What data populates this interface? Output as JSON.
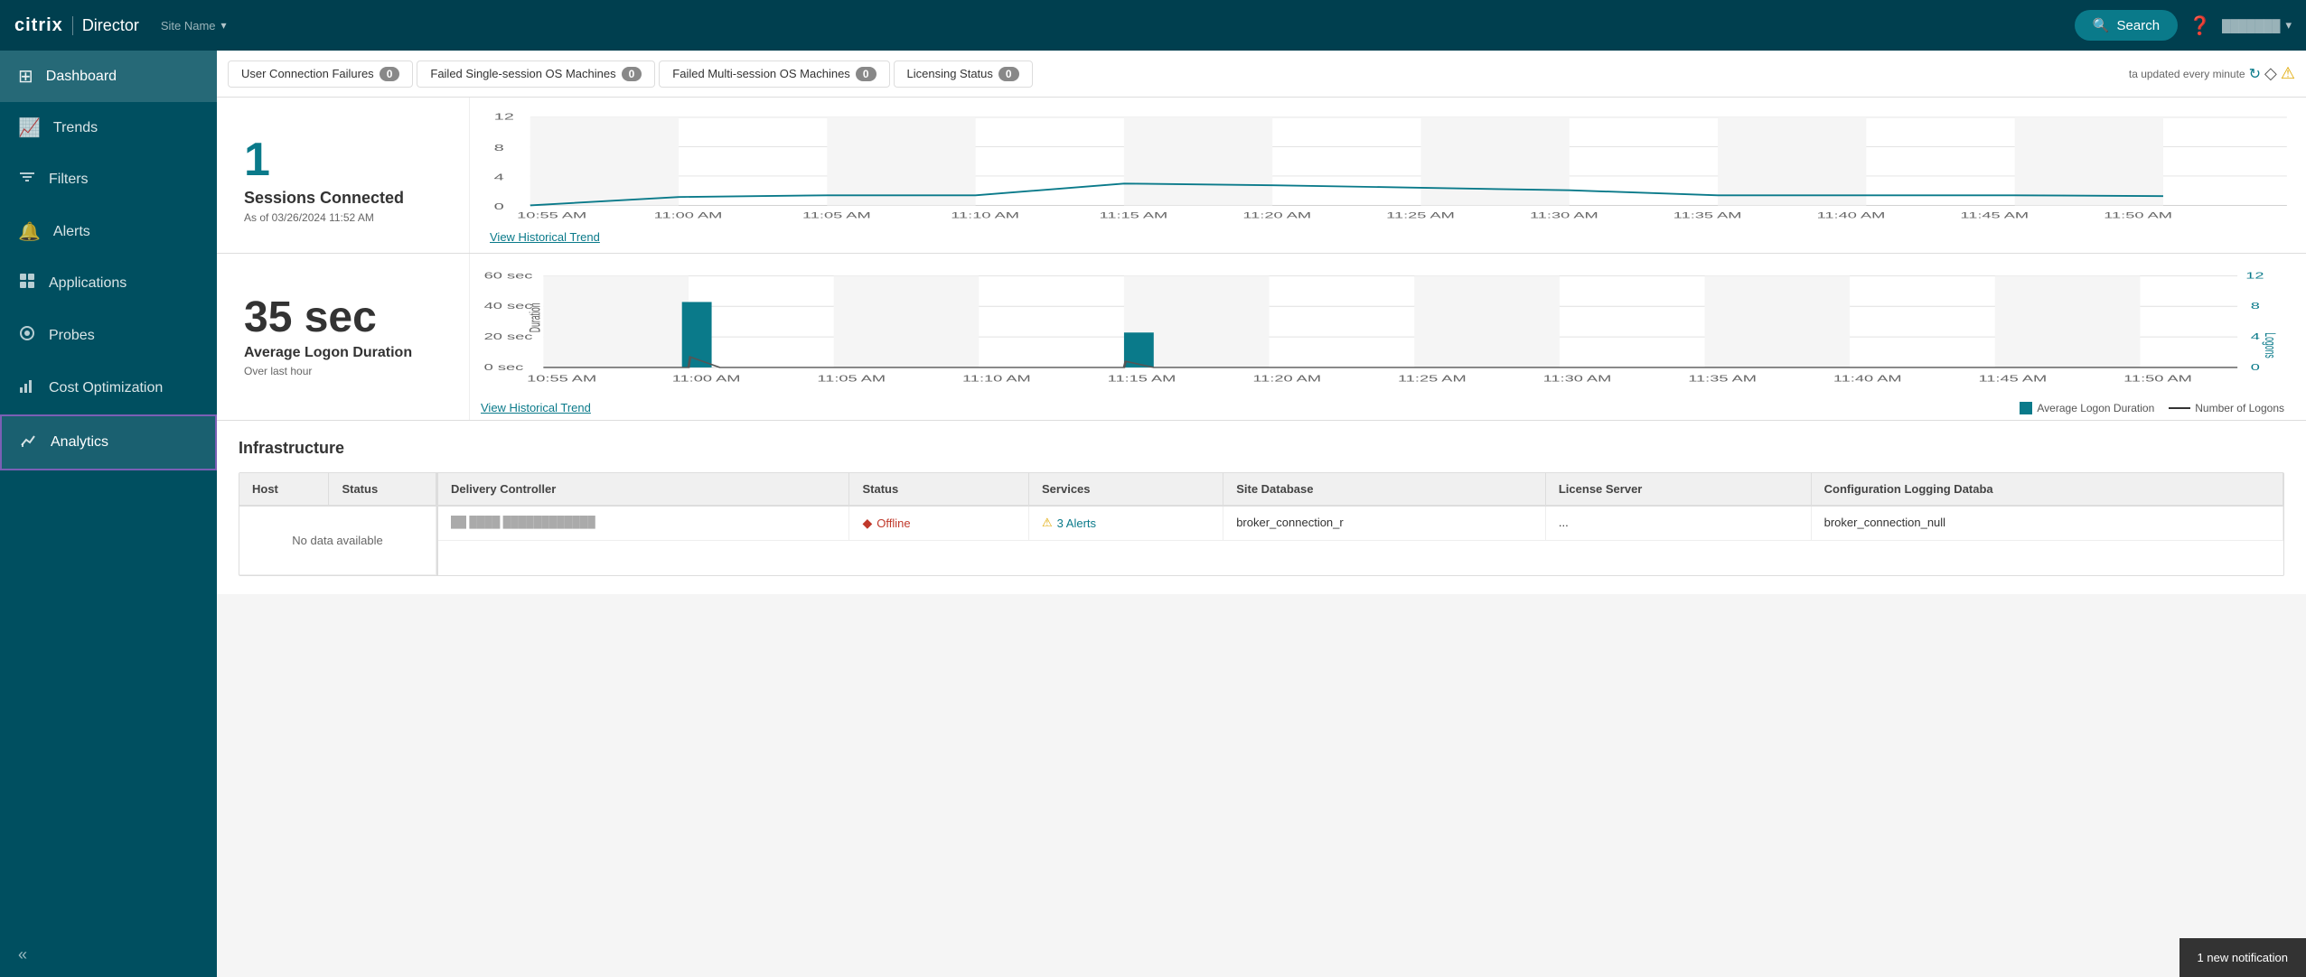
{
  "topNav": {
    "logo": "citrix",
    "appName": "Director",
    "siteSelector": "Site Name",
    "searchLabel": "Search",
    "helpLabel": "?",
    "userLabel": "Username"
  },
  "sidebar": {
    "items": [
      {
        "id": "dashboard",
        "label": "Dashboard",
        "icon": "⊞",
        "active": true
      },
      {
        "id": "trends",
        "label": "Trends",
        "icon": "📈"
      },
      {
        "id": "filters",
        "label": "Filters",
        "icon": "⚙"
      },
      {
        "id": "alerts",
        "label": "Alerts",
        "icon": "🔔"
      },
      {
        "id": "applications",
        "label": "Applications",
        "icon": "▣"
      },
      {
        "id": "probes",
        "label": "Probes",
        "icon": "⊙"
      },
      {
        "id": "costOptimization",
        "label": "Cost Optimization",
        "icon": "📊"
      },
      {
        "id": "analytics",
        "label": "Analytics",
        "icon": "📉",
        "selected": true
      }
    ],
    "collapseLabel": "«"
  },
  "alertBar": {
    "items": [
      {
        "id": "userConnFailures",
        "label": "User Connection Failures",
        "count": "0"
      },
      {
        "id": "failedSingle",
        "label": "Failed Single-session OS Machines",
        "count": "0"
      },
      {
        "id": "failedMulti",
        "label": "Failed Multi-session OS Machines",
        "count": "0"
      },
      {
        "id": "licensingStatus",
        "label": "Licensing Status",
        "count": "0"
      }
    ],
    "updateText": "ta updated every minute"
  },
  "sessionsChart": {
    "metricValue": "1",
    "metricLabel": "Sessions Connected",
    "metricSub": "As of 03/26/2024 11:52 AM",
    "viewTrendLabel": "View Historical Trend",
    "timeLabels": [
      "10:55 AM",
      "11:00 AM",
      "11:05 AM",
      "11:10 AM",
      "11:15 AM",
      "11:20 AM",
      "11:25 AM",
      "11:30 AM",
      "11:35 AM",
      "11:40 AM",
      "11:45 AM",
      "11:50 AM"
    ],
    "yLabels": [
      "0",
      "4",
      "8",
      "12"
    ],
    "dataPoints": [
      0,
      0.3,
      0.4,
      0.4,
      1.2,
      1.0,
      0.8,
      0.6,
      0.3,
      0.3,
      0.3,
      0.2
    ]
  },
  "logonChart": {
    "metricValue": "35 sec",
    "metricLabel": "Average Logon Duration",
    "metricSub": "Over last hour",
    "viewTrendLabel": "View Historical Trend",
    "timeLabels": [
      "10:55 AM",
      "11:00 AM",
      "11:05 AM",
      "11:10 AM",
      "11:15 AM",
      "11:20 AM",
      "11:25 AM",
      "11:30 AM",
      "11:35 AM",
      "11:40 AM",
      "11:45 AM",
      "11:50 AM"
    ],
    "yLabels": [
      "0 sec",
      "20 sec",
      "40 sec",
      "60 sec"
    ],
    "durationBars": [
      0,
      42,
      0,
      0,
      28,
      0,
      0,
      0,
      0,
      0,
      0,
      0
    ],
    "logonCounts": [
      0,
      1,
      0,
      0,
      1,
      0,
      0,
      0,
      0,
      0,
      0,
      0
    ],
    "legendDuration": "Average Logon Duration",
    "legendLogons": "Number of Logons",
    "rightYLabels": [
      "0",
      "4",
      "8",
      "12"
    ]
  },
  "infrastructure": {
    "title": "Infrastructure",
    "hostTable": {
      "columns": [
        "Host",
        "Status"
      ],
      "noDataText": "No data available"
    },
    "dcTable": {
      "columns": [
        "Delivery Controller",
        "Status",
        "Services",
        "Site Database",
        "License Server",
        "Configuration Logging Databa"
      ],
      "rows": [
        {
          "controller": "dc-0000-controller-000",
          "status": "Offline",
          "services": "3 Alerts",
          "siteDatabase": "broker_connection_r",
          "licenseServer": "...",
          "configLogging": "broker_connection_null"
        }
      ]
    }
  },
  "notification": {
    "label": "1 new notification"
  },
  "colors": {
    "teal": "#0a7a8a",
    "darkTeal": "#003f4f",
    "sidebarBg": "#004f60",
    "alertOrange": "#e0a800",
    "offlineRed": "#c0392b",
    "analyticsBorder": "#7b5fb5"
  }
}
